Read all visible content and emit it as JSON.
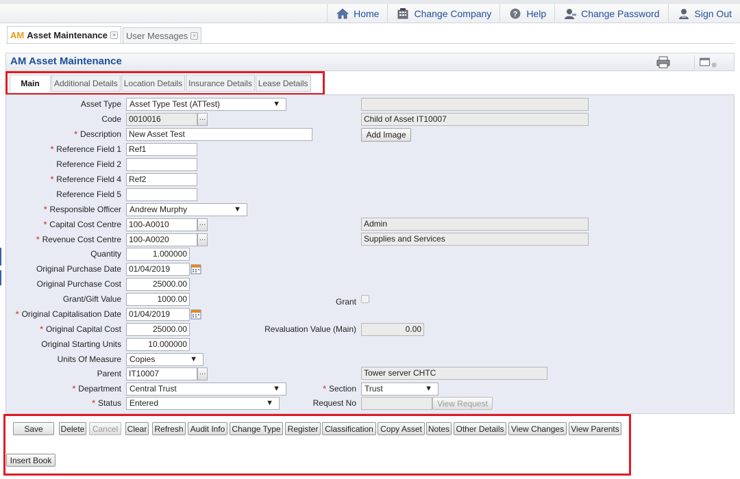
{
  "topnav": {
    "items": [
      {
        "label": "Home",
        "icon": "home-icon"
      },
      {
        "label": "Change Company",
        "icon": "building-icon"
      },
      {
        "label": "Help",
        "icon": "help-icon"
      },
      {
        "label": "Change Password",
        "icon": "user-key-icon"
      },
      {
        "label": "Sign Out",
        "icon": "sign-out-icon"
      }
    ]
  },
  "outer_tabs": [
    {
      "prefix": "AM",
      "label": "Asset Maintenance",
      "active": true
    },
    {
      "label": "User Messages",
      "active": false
    }
  ],
  "panel": {
    "title": "AM Asset Maintenance"
  },
  "inner_tabs": [
    "Main",
    "Additional Details",
    "Location Details",
    "Insurance Details",
    "Lease Details"
  ],
  "form": {
    "asset_type": {
      "label": "Asset Type",
      "value": "Asset Type Test (ATTest)"
    },
    "asset_type_desc": "",
    "code": {
      "label": "Code",
      "value": "0010016"
    },
    "code_desc": "Child of Asset IT10007",
    "description": {
      "label": "Description",
      "value": "New Asset Test"
    },
    "add_image": "Add Image",
    "ref1": {
      "label": "Reference Field 1",
      "value": "Ref1"
    },
    "ref2": {
      "label": "Reference Field 2",
      "value": ""
    },
    "ref4": {
      "label": "Reference Field 4",
      "value": "Ref2"
    },
    "ref5": {
      "label": "Reference Field 5",
      "value": ""
    },
    "responsible_officer": {
      "label": "Responsible Officer",
      "value": "Andrew Murphy"
    },
    "capital_cost_centre": {
      "label": "Capital Cost Centre",
      "value": "100-A0010",
      "desc": "Admin"
    },
    "revenue_cost_centre": {
      "label": "Revenue Cost Centre",
      "value": "100-A0020",
      "desc": "Supplies and Services"
    },
    "quantity": {
      "label": "Quantity",
      "value": "1.000000"
    },
    "orig_purchase_date": {
      "label": "Original Purchase Date",
      "value": "01/04/2019"
    },
    "orig_purchase_cost": {
      "label": "Original Purchase Cost",
      "value": "25000.00"
    },
    "grant_gift_value": {
      "label": "Grant/Gift Value",
      "value": "1000.00"
    },
    "grant": {
      "label": "Grant"
    },
    "orig_cap_date": {
      "label": "Original Capitalisation Date",
      "value": "01/04/2019"
    },
    "orig_capital_cost": {
      "label": "Original Capital Cost",
      "value": "25000.00"
    },
    "revaluation_value": {
      "label": "Revaluation Value (Main)",
      "value": "0.00"
    },
    "orig_starting_units": {
      "label": "Original Starting Units",
      "value": "10.000000"
    },
    "units_of_measure": {
      "label": "Units Of Measure",
      "value": "Copies"
    },
    "parent": {
      "label": "Parent",
      "value": "IT10007",
      "desc": "Tower server CHTC"
    },
    "department": {
      "label": "Department",
      "value": "Central Trust"
    },
    "section": {
      "label": "Section",
      "value": "Trust"
    },
    "status": {
      "label": "Status",
      "value": "Entered"
    },
    "request_no": {
      "label": "Request No",
      "value": ""
    },
    "view_request": "View Request"
  },
  "buttons": [
    "Save",
    "Delete",
    "Cancel",
    "Clear",
    "Refresh",
    "Audit Info",
    "Change Type",
    "Register",
    "Classification",
    "Copy Asset",
    "Notes",
    "Other Details",
    "View Changes",
    "View Parents"
  ],
  "insert_book": "Insert Book"
}
